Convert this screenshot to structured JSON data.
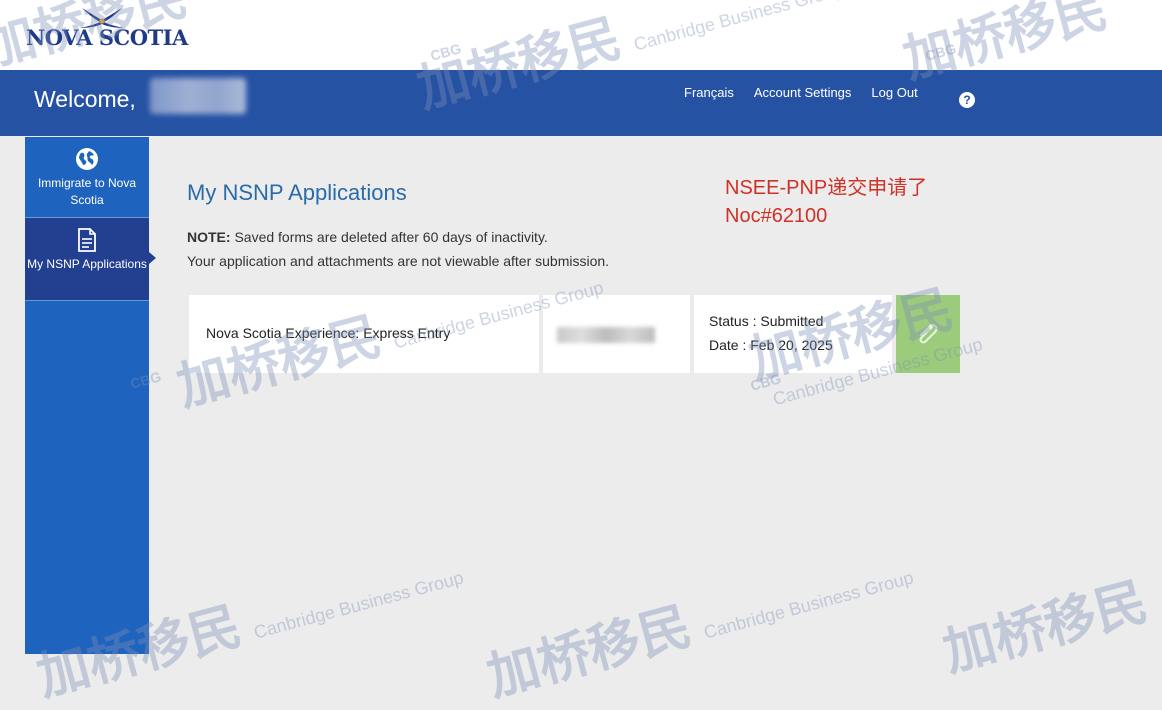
{
  "logo": {
    "text": "NOVA SCOTIA"
  },
  "header": {
    "welcome": "Welcome,",
    "links": [
      "Français",
      "Account Settings",
      "Log Out"
    ],
    "help": "?"
  },
  "sidebar": {
    "items": [
      {
        "label": "Immigrate to Nova Scotia",
        "icon": "globe-icon"
      },
      {
        "label": "My NSNP Applications",
        "icon": "document-icon"
      }
    ]
  },
  "main": {
    "title": "My NSNP Applications",
    "note_label": "NOTE:",
    "note_text": "Saved forms are deleted after 60 days of inactivity.",
    "note_line2": "Your application and attachments are not viewable after submission.",
    "annotation_line1": "NSEE-PNP递交申请了",
    "annotation_line2": "Noc#62100",
    "application": {
      "name": "Nova Scotia Experience: Express Entry",
      "status": "Status : Submitted",
      "date": "Date : Feb 20, 2025",
      "attach_icon": "paperclip-icon"
    }
  },
  "watermark": {
    "cn": "加桥移民",
    "en": "Canbridge Business Group",
    "abbr": "CBG"
  },
  "colors": {
    "header": "#2652a4",
    "sidebar": "#1e63bd",
    "sidebar_active": "#233f8f",
    "title": "#2a6ba9",
    "annotation": "#d03127",
    "attach": "#9ccc7b"
  }
}
